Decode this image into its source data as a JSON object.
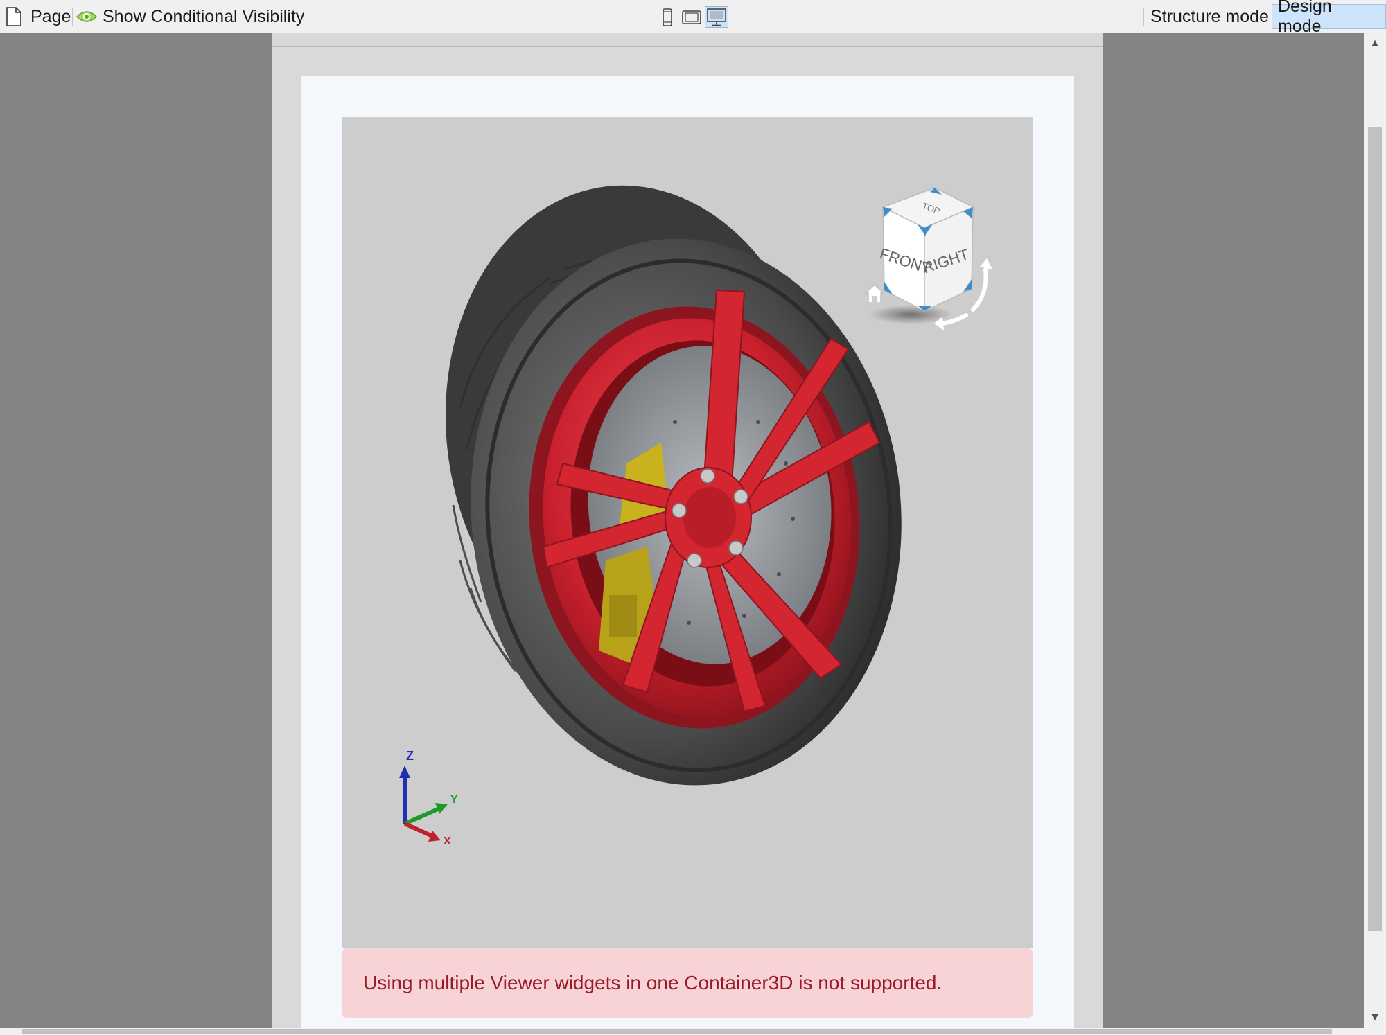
{
  "toolbar": {
    "page_label": "Page",
    "visibility_label": "Show Conditional Visibility",
    "devices": [
      "phone-icon",
      "tablet-icon",
      "desktop-icon"
    ],
    "active_device": "desktop",
    "structure_mode_label": "Structure mode",
    "design_mode_label": "Design mode",
    "active_mode": "Design mode"
  },
  "viewer": {
    "view_cube": {
      "top_label": "TOP",
      "front_label": "FRONT",
      "right_label": "RIGHT"
    },
    "axes": {
      "z": "Z",
      "y": "Y",
      "x": "X"
    },
    "model": "wheel"
  },
  "alert": {
    "message": "Using multiple Viewer widgets in one Container3D is not supported."
  },
  "colors": {
    "rim": "#c8202c",
    "tire": "#4a4a4a",
    "caliper": "#c9b21e",
    "alert_bg": "#f8d3d6",
    "alert_text": "#9a1b28",
    "active_button": "#cde4fa"
  }
}
